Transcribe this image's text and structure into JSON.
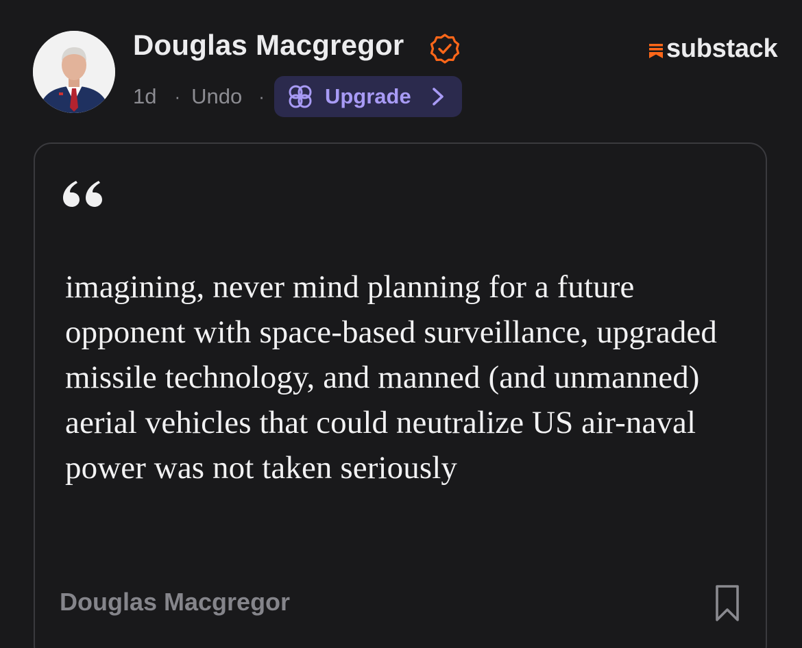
{
  "post": {
    "author_name": "Douglas Macgregor",
    "time_ago": "1d",
    "separator": "·",
    "undo_label": "Undo",
    "upgrade_label": "Upgrade",
    "icons": {
      "verified": "verified-check-icon",
      "upgrade": "flower-icon",
      "chevron": "chevron-right-icon",
      "bookmark": "bookmark-icon",
      "quote": "quote-mark-icon"
    }
  },
  "brand": {
    "name": "substack",
    "accent_color": "#ff6719",
    "upgrade_color": "#a89bf5"
  },
  "card": {
    "quote_text": "imagining, never mind planning for a future opponent with space-based surveillance, upgraded missile technology, and manned (and unmanned) aerial vehicles that could neutralize US air-naval power was not taken seriously",
    "attribution": "Douglas Macgregor"
  }
}
